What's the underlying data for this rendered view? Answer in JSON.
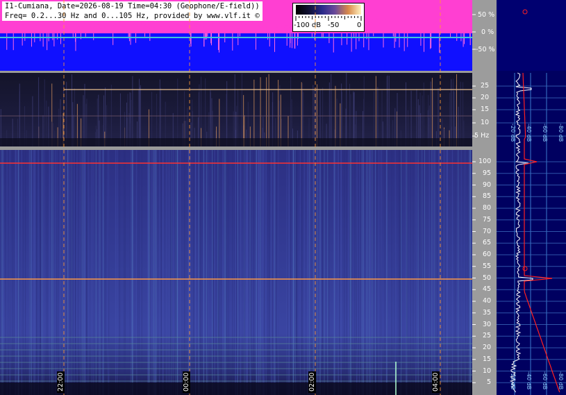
{
  "header": {
    "line1": "I1-Cumiana, Date=2026-08-19 Time=04:30 (Geophone/E-field))",
    "line2": "Freq= 0.2...30 Hz and 0...105 Hz, provided by www.vlf.it ©"
  },
  "colorbar": {
    "min_label": "-100 dB",
    "mid_label": "-50",
    "max_label": "0"
  },
  "amplitude_axis": {
    "labels": [
      "50 %",
      "0 %",
      "-50 %"
    ]
  },
  "upper_freq_axis": {
    "labels": [
      "25",
      "20",
      "15",
      "10",
      "5 Hz"
    ]
  },
  "lower_freq_axis": {
    "labels": [
      "100",
      "95",
      "90",
      "85",
      "80",
      "75",
      "70",
      "65",
      "60",
      "55",
      "50",
      "45",
      "40",
      "35",
      "30",
      "25",
      "20",
      "15",
      "10",
      "5"
    ]
  },
  "time_axis": {
    "labels": [
      "22:00",
      "00:00",
      "02:00",
      "04:00"
    ]
  },
  "db_scale": {
    "labels": [
      "-20 dB",
      "-40 dB",
      "-60 dB",
      "-80 dB",
      "-100 dB"
    ]
  },
  "colors": {
    "magenta": "#ff3fd2",
    "blue": "#1010ff",
    "cyan": "#40c8d8",
    "marker": "#ff9933",
    "red": "#ff2020",
    "panel": "#000060"
  }
}
